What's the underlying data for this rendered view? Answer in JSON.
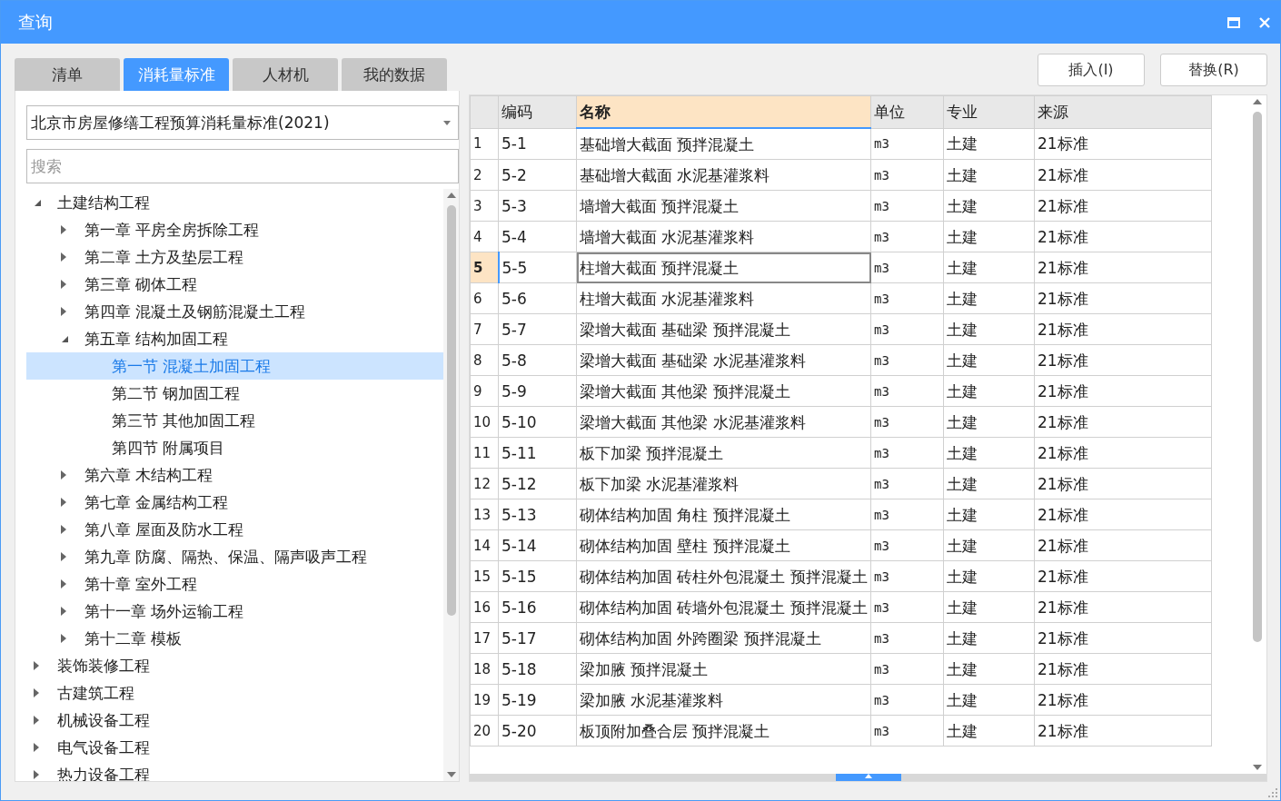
{
  "window": {
    "title": "查询"
  },
  "tabs": [
    {
      "label": "清单",
      "selected": false
    },
    {
      "label": "消耗量标准",
      "selected": true
    },
    {
      "label": "人材机",
      "selected": false
    },
    {
      "label": "我的数据",
      "selected": false
    }
  ],
  "buttons": [
    "插入(I)",
    "替换(R)"
  ],
  "library_select": {
    "value": "北京市房屋修缮工程预算消耗量标准(2021)"
  },
  "search": {
    "placeholder": "搜索"
  },
  "tree": [
    {
      "label": "土建结构工程",
      "expanded": true,
      "selected": false,
      "children": [
        {
          "label": "第一章 平房全房拆除工程",
          "expanded": false,
          "selected": false
        },
        {
          "label": "第二章 土方及垫层工程",
          "expanded": false,
          "selected": false
        },
        {
          "label": "第三章 砌体工程",
          "expanded": false,
          "selected": false
        },
        {
          "label": "第四章 混凝土及钢筋混凝土工程",
          "expanded": false,
          "selected": false
        },
        {
          "label": "第五章 结构加固工程",
          "expanded": true,
          "selected": false,
          "children": [
            {
              "label": "第一节 混凝土加固工程",
              "selected": true
            },
            {
              "label": "第二节 钢加固工程",
              "selected": false
            },
            {
              "label": "第三节 其他加固工程",
              "selected": false
            },
            {
              "label": "第四节 附属项目",
              "selected": false
            }
          ]
        },
        {
          "label": "第六章 木结构工程",
          "expanded": false,
          "selected": false
        },
        {
          "label": "第七章 金属结构工程",
          "expanded": false,
          "selected": false
        },
        {
          "label": "第八章 屋面及防水工程",
          "expanded": false,
          "selected": false
        },
        {
          "label": "第九章 防腐、隔热、保温、隔声吸声工程",
          "expanded": false,
          "selected": false
        },
        {
          "label": "第十章 室外工程",
          "expanded": false,
          "selected": false
        },
        {
          "label": "第十一章 场外运输工程",
          "expanded": false,
          "selected": false
        },
        {
          "label": "第十二章 模板",
          "expanded": false,
          "selected": false
        }
      ]
    },
    {
      "label": "装饰装修工程",
      "expanded": false,
      "selected": false
    },
    {
      "label": "古建筑工程",
      "expanded": false,
      "selected": false
    },
    {
      "label": "机械设备工程",
      "expanded": false,
      "selected": false
    },
    {
      "label": "电气设备工程",
      "expanded": false,
      "selected": false
    },
    {
      "label": "热力设备工程",
      "expanded": false,
      "selected": false
    }
  ],
  "table": {
    "columns": [
      {
        "label": "编码",
        "selected": false
      },
      {
        "label": "名称",
        "selected": true
      },
      {
        "label": "单位",
        "selected": false
      },
      {
        "label": "专业",
        "selected": false
      },
      {
        "label": "来源",
        "selected": false
      }
    ],
    "rows": [
      {
        "index": "1",
        "code": "5-1",
        "name": "基础增大截面 预拌混凝土",
        "unit": "m3",
        "discipline": "土建",
        "source": "21标准",
        "selected": false
      },
      {
        "index": "2",
        "code": "5-2",
        "name": "基础增大截面 水泥基灌浆料",
        "unit": "m3",
        "discipline": "土建",
        "source": "21标准",
        "selected": false
      },
      {
        "index": "3",
        "code": "5-3",
        "name": "墙增大截面 预拌混凝土",
        "unit": "m3",
        "discipline": "土建",
        "source": "21标准",
        "selected": false
      },
      {
        "index": "4",
        "code": "5-4",
        "name": "墙增大截面 水泥基灌浆料",
        "unit": "m3",
        "discipline": "土建",
        "source": "21标准",
        "selected": false
      },
      {
        "index": "5",
        "code": "5-5",
        "name": "柱增大截面 预拌混凝土",
        "unit": "m3",
        "discipline": "土建",
        "source": "21标准",
        "selected": true
      },
      {
        "index": "6",
        "code": "5-6",
        "name": "柱增大截面 水泥基灌浆料",
        "unit": "m3",
        "discipline": "土建",
        "source": "21标准",
        "selected": false
      },
      {
        "index": "7",
        "code": "5-7",
        "name": "梁增大截面 基础梁 预拌混凝土",
        "unit": "m3",
        "discipline": "土建",
        "source": "21标准",
        "selected": false
      },
      {
        "index": "8",
        "code": "5-8",
        "name": "梁增大截面 基础梁 水泥基灌浆料",
        "unit": "m3",
        "discipline": "土建",
        "source": "21标准",
        "selected": false
      },
      {
        "index": "9",
        "code": "5-9",
        "name": "梁增大截面 其他梁 预拌混凝土",
        "unit": "m3",
        "discipline": "土建",
        "source": "21标准",
        "selected": false
      },
      {
        "index": "10",
        "code": "5-10",
        "name": "梁增大截面 其他梁 水泥基灌浆料",
        "unit": "m3",
        "discipline": "土建",
        "source": "21标准",
        "selected": false
      },
      {
        "index": "11",
        "code": "5-11",
        "name": "板下加梁 预拌混凝土",
        "unit": "m3",
        "discipline": "土建",
        "source": "21标准",
        "selected": false
      },
      {
        "index": "12",
        "code": "5-12",
        "name": "板下加梁 水泥基灌浆料",
        "unit": "m3",
        "discipline": "土建",
        "source": "21标准",
        "selected": false
      },
      {
        "index": "13",
        "code": "5-13",
        "name": "砌体结构加固 角柱 预拌混凝土",
        "unit": "m3",
        "discipline": "土建",
        "source": "21标准",
        "selected": false
      },
      {
        "index": "14",
        "code": "5-14",
        "name": "砌体结构加固 壁柱 预拌混凝土",
        "unit": "m3",
        "discipline": "土建",
        "source": "21标准",
        "selected": false
      },
      {
        "index": "15",
        "code": "5-15",
        "name": "砌体结构加固 砖柱外包混凝土 预拌混凝土",
        "unit": "m3",
        "discipline": "土建",
        "source": "21标准",
        "selected": false
      },
      {
        "index": "16",
        "code": "5-16",
        "name": "砌体结构加固 砖墙外包混凝土 预拌混凝土",
        "unit": "m3",
        "discipline": "土建",
        "source": "21标准",
        "selected": false
      },
      {
        "index": "17",
        "code": "5-17",
        "name": "砌体结构加固 外跨圈梁 预拌混凝土",
        "unit": "m3",
        "discipline": "土建",
        "source": "21标准",
        "selected": false
      },
      {
        "index": "18",
        "code": "5-18",
        "name": "梁加腋 预拌混凝土",
        "unit": "m3",
        "discipline": "土建",
        "source": "21标准",
        "selected": false
      },
      {
        "index": "19",
        "code": "5-19",
        "name": "梁加腋 水泥基灌浆料",
        "unit": "m3",
        "discipline": "土建",
        "source": "21标准",
        "selected": false
      },
      {
        "index": "20",
        "code": "5-20",
        "name": "板顶附加叠合层 预拌混凝土",
        "unit": "m3",
        "discipline": "土建",
        "source": "21标准",
        "selected": false
      }
    ]
  }
}
